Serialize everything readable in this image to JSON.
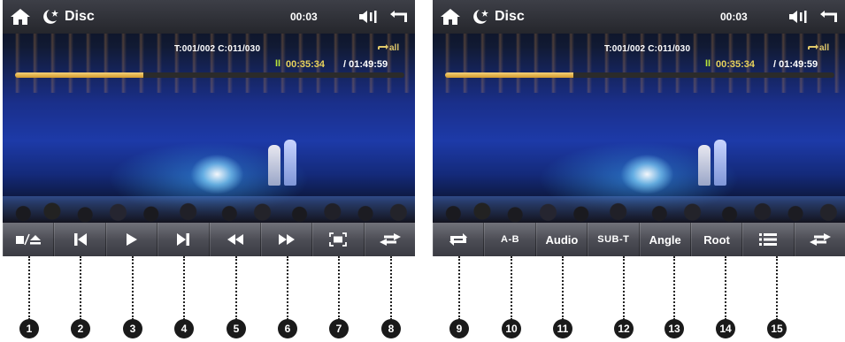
{
  "screens": [
    {
      "status": {
        "source": "Disc",
        "clock": "00:03"
      },
      "info": {
        "track": "T:001/002 C:011/030",
        "repeat": "all",
        "play_state": "II",
        "elapsed": "00:35:34",
        "total": "/ 01:49:59",
        "progress_fraction": 0.33
      },
      "controls": [
        {
          "name": "stop-eject-button",
          "icon": "stop-eject-icon",
          "callout": "1"
        },
        {
          "name": "previous-button",
          "icon": "skip-previous-icon",
          "callout": "2"
        },
        {
          "name": "play-button",
          "icon": "play-icon",
          "callout": "3"
        },
        {
          "name": "next-button",
          "icon": "skip-next-icon",
          "callout": "4"
        },
        {
          "name": "rewind-button",
          "icon": "rewind-icon",
          "callout": "5"
        },
        {
          "name": "fast-forward-button",
          "icon": "fast-forward-icon",
          "callout": "6"
        },
        {
          "name": "zoom-button",
          "icon": "zoom-frame-icon",
          "callout": "7"
        },
        {
          "name": "switch-page-button",
          "icon": "swap-arrows-icon",
          "callout": "8"
        }
      ]
    },
    {
      "status": {
        "source": "Disc",
        "clock": "00:03"
      },
      "info": {
        "track": "T:001/002 C:011/030",
        "repeat": "all",
        "play_state": "II",
        "elapsed": "00:35:34",
        "total": "/ 01:49:59",
        "progress_fraction": 0.33
      },
      "controls": [
        {
          "name": "repeat-button",
          "icon": "repeat-icon",
          "callout": "9"
        },
        {
          "name": "a-b-button",
          "label": "A-B",
          "callout": "10"
        },
        {
          "name": "audio-button",
          "label": "Audio",
          "callout": "11"
        },
        {
          "name": "subtitle-button",
          "label": "SUB-T",
          "callout": "12"
        },
        {
          "name": "angle-button",
          "label": "Angle",
          "callout": "13"
        },
        {
          "name": "root-button",
          "label": "Root",
          "callout": "14"
        },
        {
          "name": "menu-button",
          "icon": "list-icon",
          "callout": "15"
        },
        {
          "name": "switch-page-button",
          "icon": "swap-arrows-icon"
        }
      ]
    }
  ]
}
